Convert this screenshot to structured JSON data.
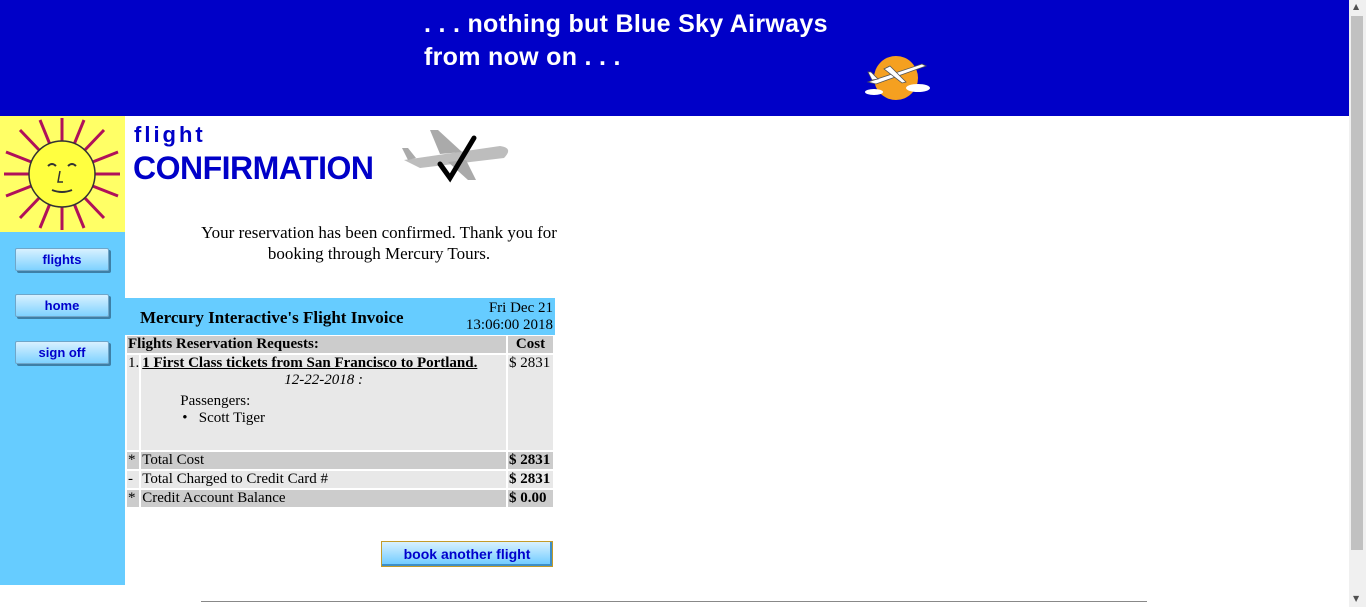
{
  "banner": {
    "line1": ". . . nothing but Blue Sky Airways",
    "line2": "from now on . . .",
    "logo_icon": "airplane-sun-logo-icon"
  },
  "sidebar": {
    "logo_icon": "sun-face-icon",
    "nav": {
      "flights": "flights",
      "home": "home",
      "signoff": "sign off"
    }
  },
  "title": {
    "small": "flight",
    "large": "CONFIRMATION",
    "icon": "plane-checkmark-icon"
  },
  "message": "Your reservation has been confirmed. Thank you for booking through Mercury Tours.",
  "invoice": {
    "title": "Mercury Interactive's Flight Invoice",
    "date_line1": "Fri Dec 21",
    "date_line2": "13:06:00 2018",
    "col_requests": "Flights Reservation Requests:",
    "col_cost": "Cost",
    "item_number": "1.",
    "item_desc": "1 First Class tickets from San Francisco to Portland.",
    "item_date": "12-22-2018 :",
    "passengers_label": "Passengers:",
    "passenger_name": "Scott Tiger",
    "item_cost": "$ 2831",
    "rows": [
      {
        "mark": "*",
        "label": "Total Cost",
        "value": "$ 2831"
      },
      {
        "mark": "-",
        "label": "Total Charged to Credit Card #",
        "value": "$ 2831"
      },
      {
        "mark": "*",
        "label": "Credit Account Balance",
        "value": "$ 0.00"
      }
    ]
  },
  "book_button": "book another flight",
  "colors": {
    "banner": "#0000c8",
    "sidebar": "#66ccff",
    "sun_bg": "#ffff66",
    "title": "#0000c8"
  }
}
